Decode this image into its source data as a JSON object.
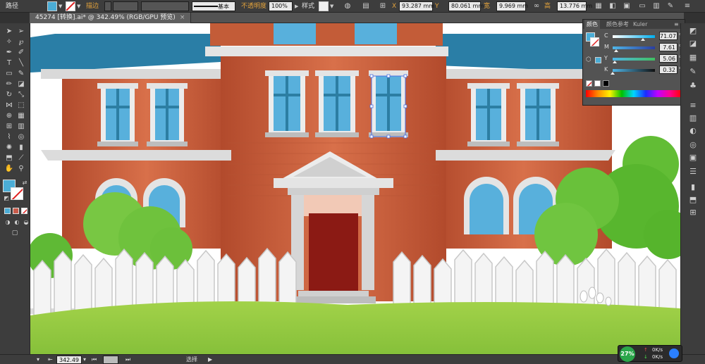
{
  "control_bar": {
    "selection_label": "路径",
    "stroke_label": "描边",
    "stroke_style": "基本",
    "opacity_label": "不透明度",
    "opacity_value": "100%",
    "style_label": "样式",
    "x_label": "X",
    "x_value": "93.287 mm",
    "y_label": "Y",
    "y_value": "80.061 mm",
    "w_label": "宽",
    "w_value": "9.969 mm",
    "h_label": "高",
    "h_value": "13.776 mm"
  },
  "document_tab": {
    "title": "45274 [转换].ai* @ 342.49% (RGB/GPU 预览)",
    "close_glyph": "×"
  },
  "color_panel": {
    "tabs": [
      "颜色",
      "颜色参考",
      "Kuler"
    ],
    "channels": [
      {
        "letter": "C",
        "value": "71.07",
        "pct": "%",
        "gradient": "linear-gradient(to right,#fff,#00aeef)"
      },
      {
        "letter": "M",
        "value": "7.61",
        "pct": "%",
        "gradient": "linear-gradient(to right,#4fb6e8,#2a3da0)"
      },
      {
        "letter": "Y",
        "value": "5.06",
        "pct": "%",
        "gradient": "linear-gradient(to right,#4fb6e8,#40c060)"
      },
      {
        "letter": "K",
        "value": "0.32",
        "pct": "%",
        "gradient": "linear-gradient(to right,#4fb6e8,#101010)"
      }
    ],
    "fill_color": "#4badd6"
  },
  "status_bar": {
    "zoom_value": "342.49",
    "mode_label": "选择"
  },
  "network_widget": {
    "percent": "27%",
    "up_speed": "0K/s",
    "down_speed": "0K/s"
  },
  "colors": {
    "ui_dark": "#3d3d3d",
    "fill_blue": "#4badd6",
    "brick": "#c75a34",
    "door": "#8b1a14",
    "grass": "#8dc63f",
    "roof": "#2a7ea6"
  }
}
